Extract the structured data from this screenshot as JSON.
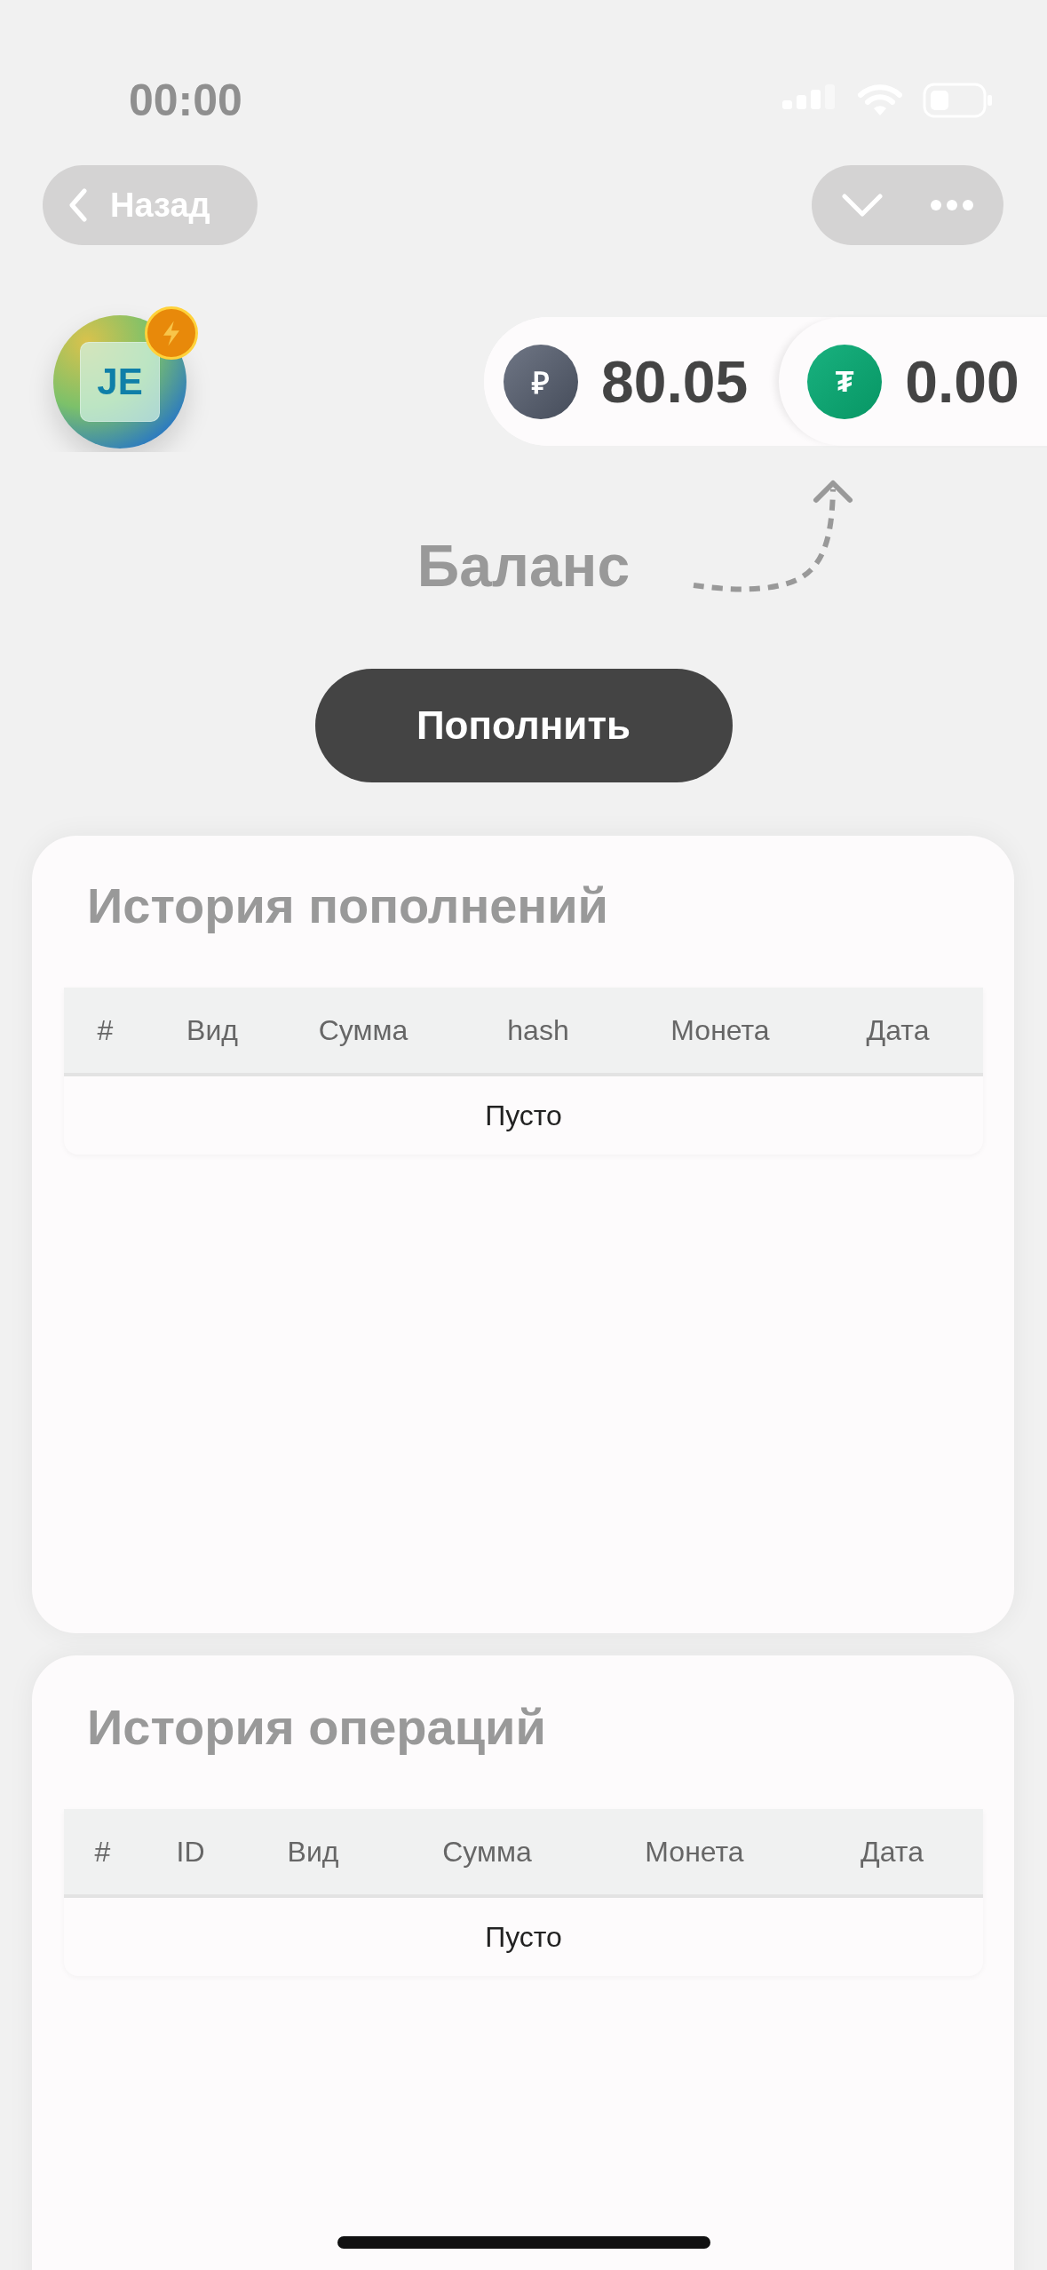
{
  "status_bar": {
    "time": "00:00"
  },
  "nav": {
    "back_label": "Назад"
  },
  "avatar": {
    "initials": "JE"
  },
  "balances": [
    {
      "kind": "rub",
      "symbol": "₽",
      "amount": "80.05"
    },
    {
      "kind": "usdt",
      "symbol": "₮",
      "amount": "0.00"
    }
  ],
  "balance_label": "Баланс",
  "topup_button": "Пополнить",
  "cards": [
    {
      "title": "История пополнений",
      "columns": [
        "#",
        "Вид",
        "Сумма",
        "hash",
        "Монета",
        "Дата"
      ],
      "empty_text": "Пусто"
    },
    {
      "title": "История операций",
      "columns": [
        "#",
        "ID",
        "Вид",
        "Сумма",
        "Монета",
        "Дата"
      ],
      "empty_text": "Пусто"
    }
  ]
}
